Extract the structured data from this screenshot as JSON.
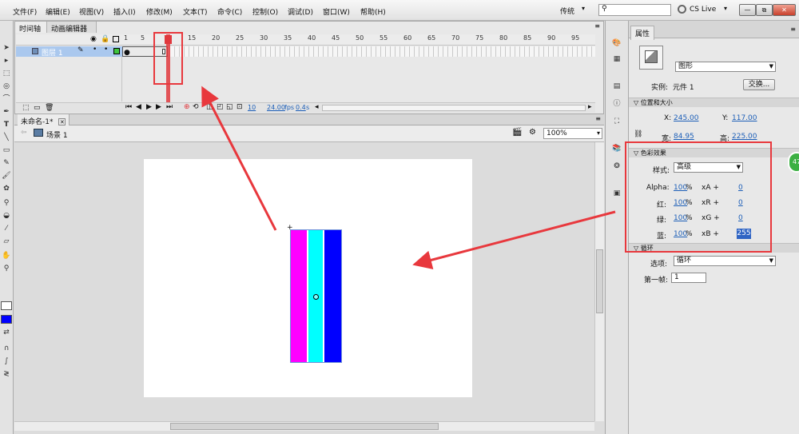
{
  "menu": {
    "items": [
      "文件(F)",
      "编辑(E)",
      "视图(V)",
      "插入(I)",
      "修改(M)",
      "文本(T)",
      "命令(C)",
      "控制(O)",
      "调试(D)",
      "窗口(W)",
      "帮助(H)"
    ]
  },
  "topbar": {
    "workspace": "传统",
    "cslive": "CS Live",
    "minimize": "—",
    "restore": "⧉",
    "close": "✕"
  },
  "timeline": {
    "tabs": [
      "时间轴",
      "动画编辑器"
    ],
    "layer_name": "图层 1",
    "frame_numbers": [
      "1",
      "5",
      "10",
      "15",
      "20",
      "25",
      "30",
      "35",
      "40",
      "45",
      "50",
      "55",
      "60",
      "65",
      "70",
      "75",
      "80",
      "85",
      "90",
      "95"
    ],
    "current_frame": "10",
    "fps": "24.00",
    "fps_unit": "fps",
    "time": "0.4",
    "time_unit": "s"
  },
  "document": {
    "tab": "未命名-1*",
    "scene": "场景 1",
    "zoom": "100%"
  },
  "stage": {
    "bar_colors": [
      "#ff00ff",
      "#00ffff",
      "#0000ff"
    ]
  },
  "properties": {
    "tab": "属性",
    "symbol_type": "图形",
    "instance_label": "实例:",
    "instance_value": "元件 1",
    "swap_button": "交换...",
    "pos_size_section": "位置和大小",
    "x_label": "X:",
    "x_value": "245.00",
    "y_label": "Y:",
    "y_value": "117.00",
    "w_label": "宽:",
    "w_value": "84.95",
    "h_label": "高:",
    "h_value": "225.00",
    "color_section": "色彩效果",
    "style_label": "样式:",
    "style_value": "高级",
    "rows": [
      {
        "label": "Alpha:",
        "pct": "100",
        "unit": "%",
        "x": "xA +",
        "offset": "0"
      },
      {
        "label": "红:",
        "pct": "100",
        "unit": "%",
        "x": "xR +",
        "offset": "0"
      },
      {
        "label": "绿:",
        "pct": "100",
        "unit": "%",
        "x": "xG +",
        "offset": "0"
      },
      {
        "label": "蓝:",
        "pct": "100",
        "unit": "%",
        "x": "xB +",
        "offset": "255"
      }
    ],
    "loop_section": "循环",
    "options_label": "选项:",
    "options_value": "循环",
    "first_frame_label": "第一帧:",
    "first_frame_value": "1"
  },
  "badge": "47",
  "colors": {
    "annotation_red": "#e8383d",
    "accent_blue": "#1d5fb8",
    "badge_green": "#3cb043"
  }
}
